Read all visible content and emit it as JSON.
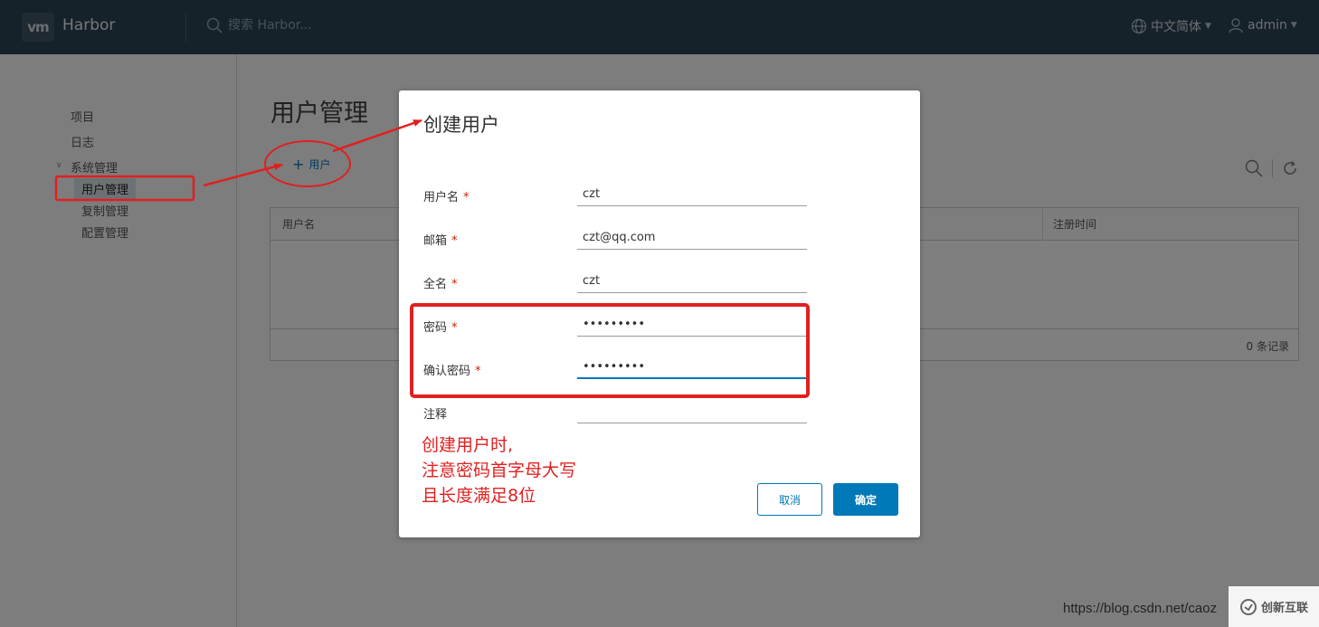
{
  "header": {
    "logo_text": "vm",
    "app_title": "Harbor",
    "search_placeholder": "搜索 Harbor...",
    "language": "中文简体",
    "username": "admin"
  },
  "sidebar": {
    "items": [
      {
        "label": "项目"
      },
      {
        "label": "日志"
      },
      {
        "label": "系统管理"
      },
      {
        "label": "用户管理"
      },
      {
        "label": "复制管理"
      },
      {
        "label": "配置管理"
      }
    ]
  },
  "main": {
    "page_title": "用户管理",
    "add_user_label": "用户",
    "datagrid": {
      "columns": [
        "用户名",
        "注册时间"
      ],
      "footer_count": "0 条记录"
    }
  },
  "modal": {
    "title": "创建用户",
    "fields": [
      {
        "label": "用户名",
        "required": "*",
        "value": "czt"
      },
      {
        "label": "邮箱",
        "required": "*",
        "value": "czt@qq.com"
      },
      {
        "label": "全名",
        "required": "*",
        "value": "czt"
      },
      {
        "label": "密码",
        "required": "*",
        "value": "123456789"
      },
      {
        "label": "确认密码",
        "required": "*",
        "value": "123456789"
      },
      {
        "label": "注释",
        "value": ""
      }
    ],
    "cancel_label": "取消",
    "ok_label": "确定"
  },
  "annotation": {
    "lines": [
      "创建用户时,",
      "注意密码首字母大写",
      "且长度满足8位"
    ],
    "color": "#e02020"
  },
  "watermark": {
    "url": "https://blog.csdn.net/caoz",
    "badge": "创新互联"
  },
  "colors": {
    "header_bg": "#2d4555",
    "primary": "#0079b8",
    "required": "#c92100"
  }
}
